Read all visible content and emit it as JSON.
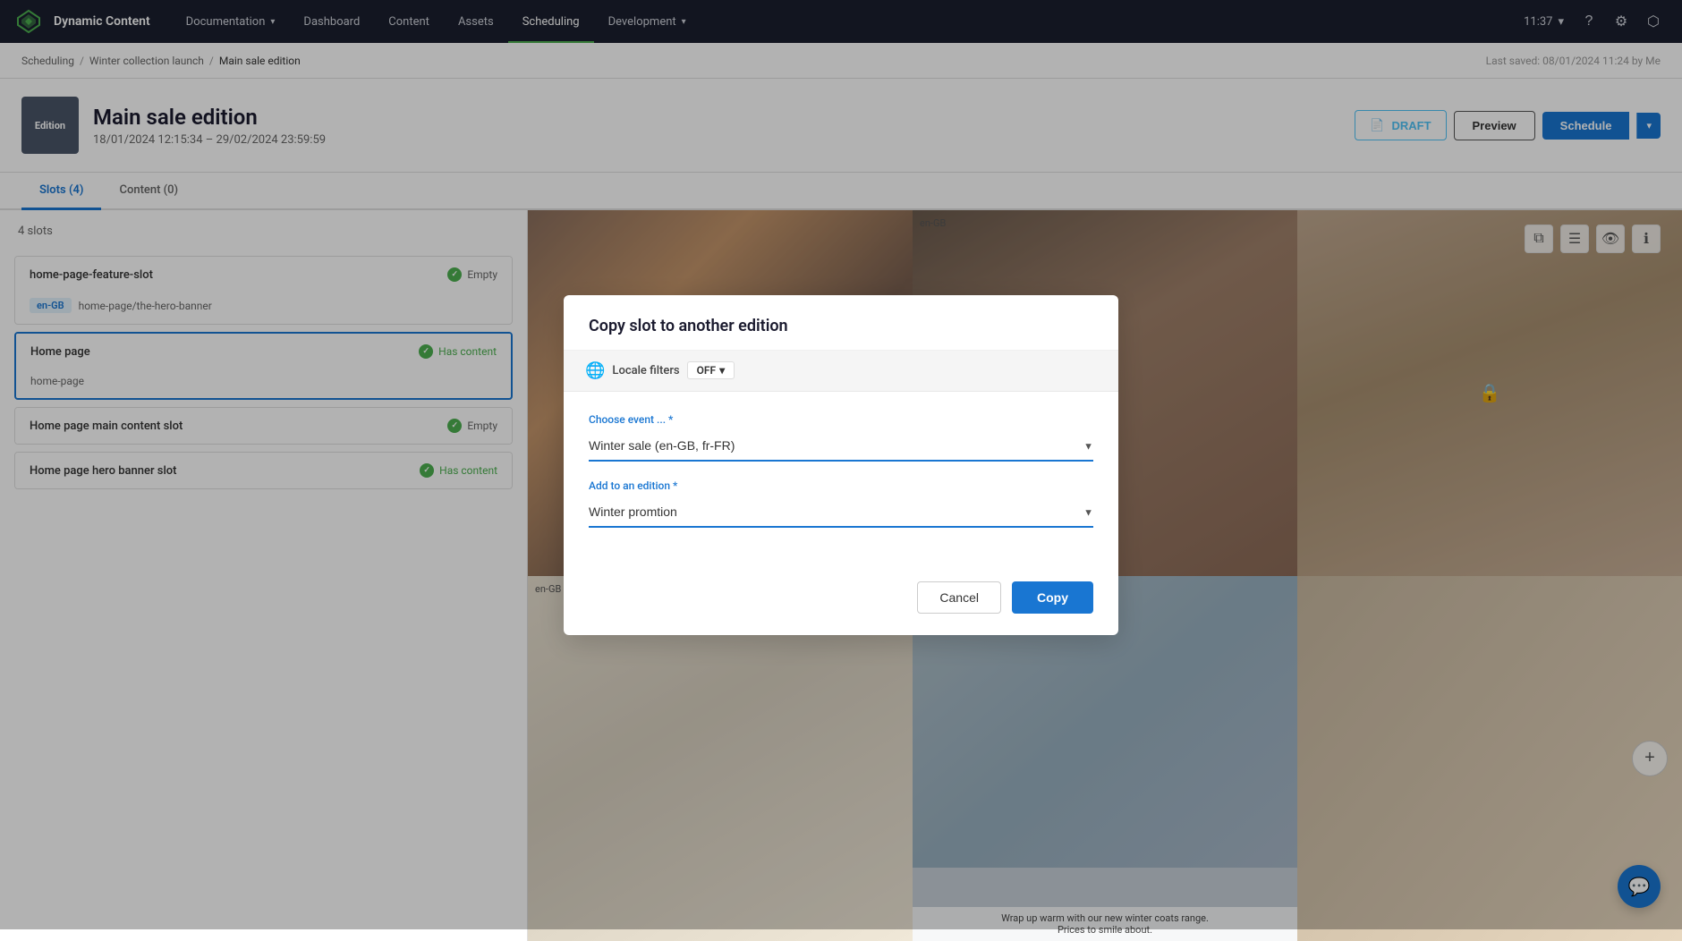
{
  "app": {
    "name": "Dynamic Content"
  },
  "nav": {
    "items": [
      {
        "label": "Documentation",
        "active": false,
        "has_dropdown": true
      },
      {
        "label": "Dashboard",
        "active": false,
        "has_dropdown": false
      },
      {
        "label": "Content",
        "active": false,
        "has_dropdown": false
      },
      {
        "label": "Assets",
        "active": false,
        "has_dropdown": false
      },
      {
        "label": "Scheduling",
        "active": true,
        "has_dropdown": false
      },
      {
        "label": "Development",
        "active": false,
        "has_dropdown": true
      }
    ],
    "time": "11:37",
    "last_saved": "Last saved: 08/01/2024 11:24 by Me"
  },
  "breadcrumb": {
    "items": [
      "Scheduling",
      "Winter collection launch",
      "Main sale edition"
    ]
  },
  "page": {
    "edition_badge": "Edition",
    "title": "Main sale edition",
    "dates": "18/01/2024 12:15:34 – 29/02/2024 23:59:59",
    "status": "DRAFT"
  },
  "buttons": {
    "preview": "Preview",
    "schedule": "Schedule",
    "draft_icon": "📄"
  },
  "tabs": {
    "slots": "Slots (4)",
    "content": "Content (0)"
  },
  "slots": {
    "count_label": "4 slots",
    "items": [
      {
        "name": "home-page-feature-slot",
        "status": "Empty",
        "locale": "en-GB",
        "path": "home-page/the-hero-banner",
        "has_content": false,
        "selected": false
      },
      {
        "name": "Home page",
        "status": "Has content",
        "locale": null,
        "path": "home-page",
        "has_content": true,
        "selected": true
      },
      {
        "name": "Home page main content slot",
        "status": "Empty",
        "locale": null,
        "path": null,
        "has_content": false,
        "selected": false
      },
      {
        "name": "Home page hero banner slot",
        "status": "Has content",
        "locale": null,
        "path": null,
        "has_content": true,
        "selected": false
      }
    ]
  },
  "right_panel": {
    "locale_labels": [
      "en-GB",
      "en-GB"
    ],
    "caption": "Wrap up warm with our new winter coats range.",
    "caption_sub": "Prices to smile about."
  },
  "modal": {
    "title": "Copy slot to another edition",
    "locale_filter_label": "Locale filters",
    "locale_filter_status": "OFF",
    "choose_event_label": "Choose event ... *",
    "choose_event_value": "Winter sale (en-GB, fr-FR)",
    "add_edition_label": "Add to an edition *",
    "add_edition_value": "Winter promtion",
    "cancel_label": "Cancel",
    "copy_label": "Copy"
  }
}
